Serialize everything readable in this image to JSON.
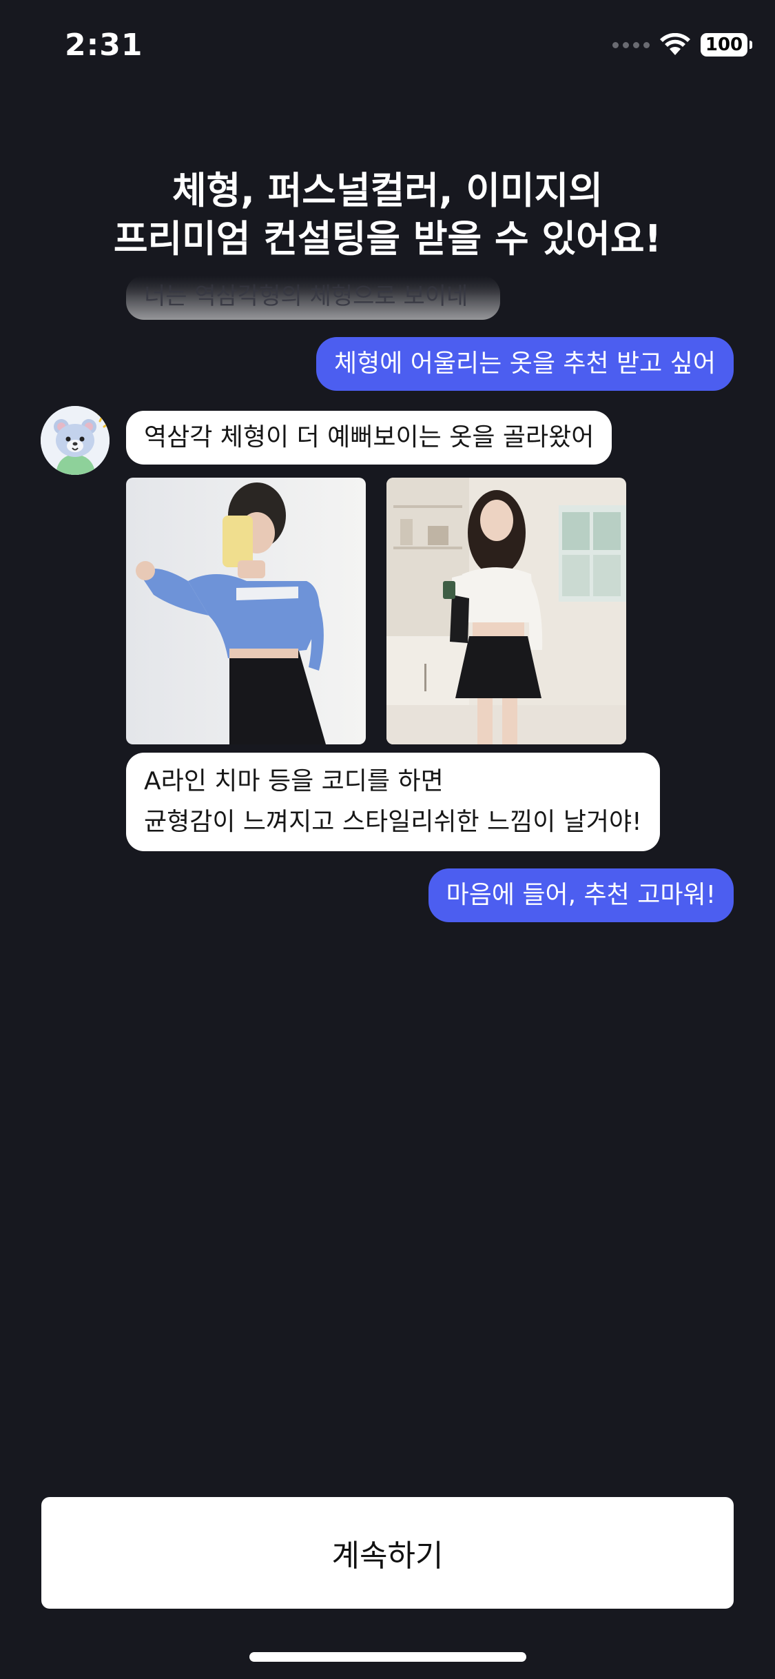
{
  "status_bar": {
    "time": "2:31",
    "battery": "100"
  },
  "headline": {
    "line1": "체형, 퍼스널컬러, 이미지의",
    "line2": "프리미엄 컨설팅을 받을 수 있어요!"
  },
  "chat": {
    "faded_message": "너는 역삼각형의 체형으로 보이네",
    "user_message_1": "체형에 어울리는 옷을 추천 받고 싶어",
    "bot_message_1": "역삼각 체형이 더 예뻐보이는 옷을 골라왔어",
    "bot_message_2_line1": "A라인 치마 등을 코디를 하면",
    "bot_message_2_line2": "균형감이 느껴지고 스타일리쉬한 느낌이 날거야!",
    "user_message_2": "마음에 들어, 추천 고마워!"
  },
  "footer": {
    "continue_label": "계속하기"
  },
  "colors": {
    "background": "#17181f",
    "user_bubble": "#4c5ef0",
    "bot_bubble": "#ffffff"
  },
  "icons": [
    "wifi-icon",
    "battery-icon",
    "bear-avatar-icon",
    "signal-dots-icon"
  ]
}
